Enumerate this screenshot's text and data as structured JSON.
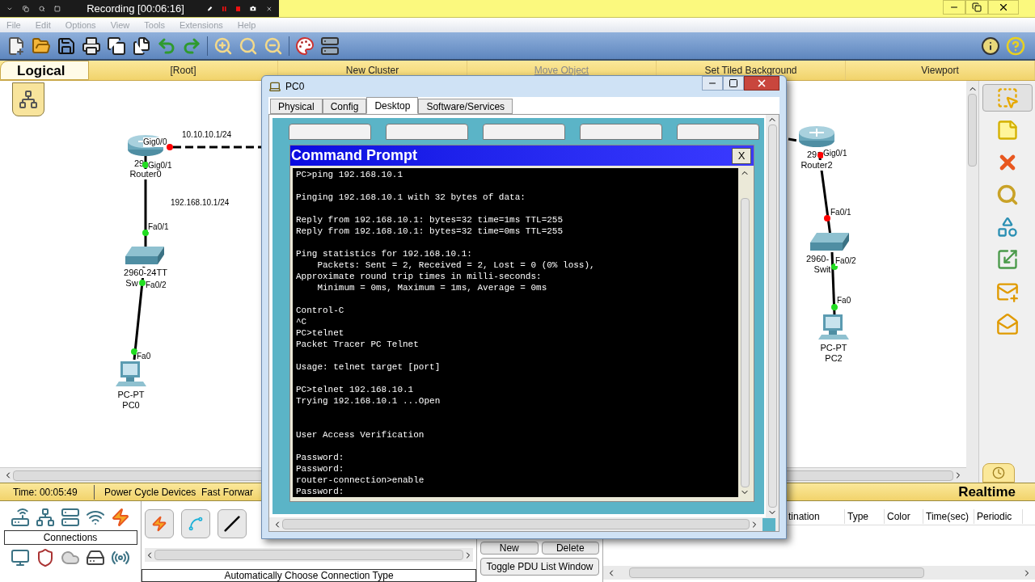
{
  "recorder": {
    "title": "Recording [00:06:16]"
  },
  "menu": [
    "File",
    "Edit",
    "Options",
    "View",
    "Tools",
    "Extensions",
    "Help"
  ],
  "workspace_bar": {
    "mode": "Logical",
    "items": [
      {
        "label": "[Root]",
        "disabled": false
      },
      {
        "label": "New Cluster",
        "disabled": false
      },
      {
        "label": "Move Object",
        "disabled": true
      },
      {
        "label": "Set Tiled Background",
        "disabled": false
      },
      {
        "label": "Viewport",
        "disabled": false
      }
    ]
  },
  "canvas": {
    "devices": [
      {
        "kind": "router",
        "model": "29",
        "name": "Router0"
      },
      {
        "kind": "switch",
        "model": "2960-24TT",
        "name": "Sw"
      },
      {
        "kind": "pc",
        "model": "PC-PT",
        "name": "PC0"
      },
      {
        "kind": "router",
        "model": "29",
        "name": "Router2"
      },
      {
        "kind": "switch",
        "model": "2960-",
        "name": "Swit"
      },
      {
        "kind": "pc",
        "model": "PC-PT",
        "name": "PC2"
      }
    ],
    "ports": [
      {
        "label": "Gig0/0",
        "color": "#ff0000"
      },
      {
        "label": "Gig0/1",
        "color": "#22dd22"
      },
      {
        "label": "Fa0/1",
        "color": "#22dd22"
      },
      {
        "label": "Fa0/2",
        "color": "#22dd22"
      },
      {
        "label": "Fa0",
        "color": "#22dd22"
      },
      {
        "label": "Gig0/1",
        "color": "#ff0000"
      },
      {
        "label": "Fa0/1",
        "color": "#ff0000"
      },
      {
        "label": "Fa0/2",
        "color": "#22dd22"
      },
      {
        "label": "Fa0",
        "color": "#22dd22"
      }
    ],
    "addresses": [
      "10.10.10.1/24",
      "192.168.10.1/24"
    ],
    "links": [
      {
        "kind": "dashed"
      },
      {
        "kind": "solid"
      },
      {
        "kind": "solid"
      },
      {
        "kind": "dashed"
      },
      {
        "kind": "solid"
      },
      {
        "kind": "solid"
      }
    ]
  },
  "tools": [
    {
      "kind": "select",
      "selected": true
    },
    {
      "kind": "note",
      "selected": false
    },
    {
      "kind": "delete",
      "selected": false
    },
    {
      "kind": "inspect",
      "selected": false
    },
    {
      "kind": "shape",
      "selected": false
    },
    {
      "kind": "resize",
      "selected": false
    },
    {
      "kind": "simple_pdu",
      "selected": false
    },
    {
      "kind": "complex_pdu",
      "selected": false
    }
  ],
  "status_bar": {
    "time": "Time: 00:05:49",
    "actions": "Power Cycle Devices  Fast Forwar",
    "mode": "Realtime"
  },
  "device_panel": {
    "category": "Connections",
    "connection_type": "Automatically Choose Connection Type"
  },
  "pdu_buttons": [
    "New",
    "Delete",
    "Toggle PDU List Window"
  ],
  "pdu_columns": [
    "tination",
    "Type",
    "Color",
    "Time(sec)",
    "Periodic"
  ],
  "pc_window": {
    "title": "PC0",
    "tabs": [
      {
        "label": "Physical",
        "selected": false
      },
      {
        "label": "Config",
        "selected": false
      },
      {
        "label": "Desktop",
        "selected": true
      },
      {
        "label": "Software/Services",
        "selected": false
      }
    ],
    "command_prompt": {
      "title": "Command Prompt",
      "close": "X",
      "blocks": [
        {
          "lines": [
            "PC>ping 192.168.10.1"
          ]
        },
        {
          "lines": [
            "Pinging 192.168.10.1 with 32 bytes of data:"
          ]
        },
        {
          "lines": [
            "Reply from 192.168.10.1: bytes=32 time=1ms TTL=255",
            "Reply from 192.168.10.1: bytes=32 time=0ms TTL=255"
          ]
        },
        {
          "lines": [
            "Ping statistics for 192.168.10.1:",
            "    Packets: Sent = 2, Received = 2, Lost = 0 (0% loss),",
            "Approximate round trip times in milli-seconds:",
            "    Minimum = 0ms, Maximum = 1ms, Average = 0ms"
          ]
        },
        {
          "lines": [
            "Control-C",
            "^C",
            "PC>telnet",
            "Packet Tracer PC Telnet"
          ]
        },
        {
          "lines": [
            "Usage: telnet target [port]"
          ]
        },
        {
          "lines": [
            "PC>telnet 192.168.10.1",
            "Trying 192.168.10.1 ...Open"
          ]
        },
        {
          "lines": [
            "User Access Verification"
          ]
        },
        {
          "lines": [
            "Password:",
            "Password:",
            "router-connection>enable",
            "Password:"
          ]
        }
      ]
    }
  }
}
